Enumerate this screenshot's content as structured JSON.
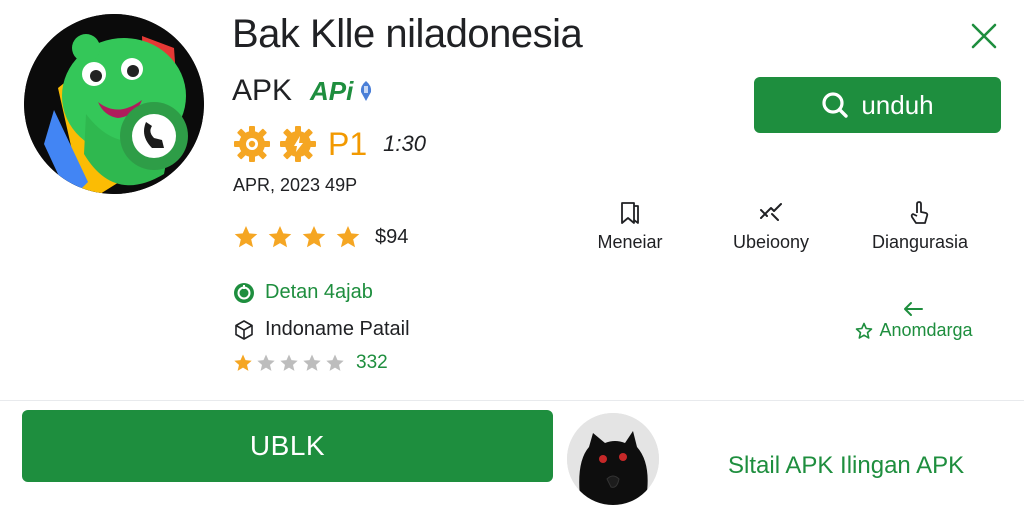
{
  "app": {
    "title": "Bak Klle niladonesia",
    "type_label": "APK",
    "tag": "APi"
  },
  "close": {
    "icon": "close-icon"
  },
  "download_button": {
    "label": "unduh",
    "icon": "search-icon"
  },
  "badges": {
    "label": "P1",
    "time": "1:30"
  },
  "meta": "APR, 2023 49P",
  "rating": {
    "stars": 4,
    "value": "$94"
  },
  "actions": [
    {
      "label": "Meneiar",
      "icon": "bookmark-icon"
    },
    {
      "label": "Ubeioony",
      "icon": "share-icon"
    },
    {
      "label": "Diangurasia",
      "icon": "hand-icon"
    }
  ],
  "details": {
    "green_line": "Detan 4ajab",
    "plain_line": "Indoname Patail",
    "small_rating": {
      "stars": 1,
      "total": 5,
      "value": "332"
    }
  },
  "recommend": {
    "label": "Anomdarga"
  },
  "bottom": {
    "unblock_label": "UBLK",
    "link_label": "Sltail APK Ilingan APK"
  },
  "colors": {
    "brand_green": "#1e8e3e",
    "star_gold": "#f5a623",
    "badge_orange": "#f29900"
  }
}
